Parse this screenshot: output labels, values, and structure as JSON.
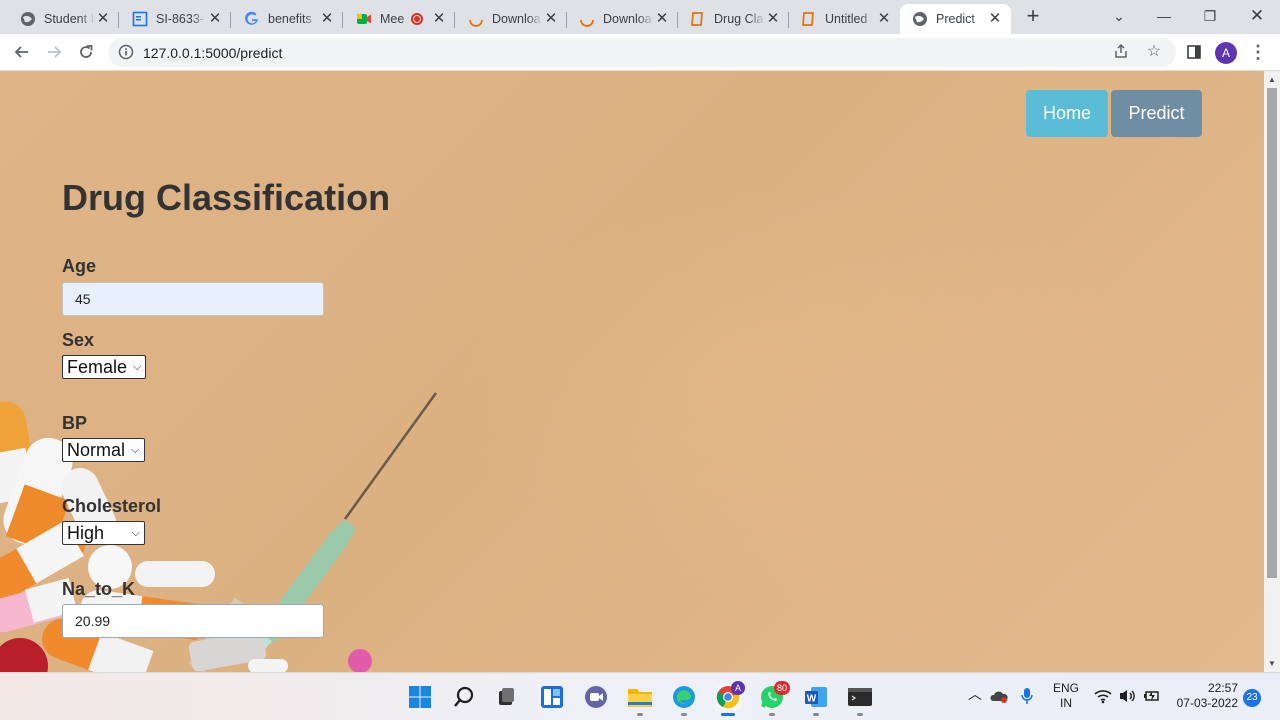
{
  "browser": {
    "tabs": [
      {
        "title": "Student I",
        "icon": "globe-icon"
      },
      {
        "title": "SI-8633-",
        "icon": "doc-icon"
      },
      {
        "title": "benefits",
        "icon": "google-icon"
      },
      {
        "title": "Mee",
        "icon": "meet-icon",
        "recording": true
      },
      {
        "title": "Downloa",
        "icon": "loading-icon"
      },
      {
        "title": "Downloa",
        "icon": "loading-icon"
      },
      {
        "title": "Drug Cla",
        "icon": "book-icon"
      },
      {
        "title": "Untitled",
        "icon": "book-icon"
      },
      {
        "title": "Predict",
        "icon": "globe-icon",
        "active": true
      }
    ],
    "url": "127.0.0.1:5000/predict",
    "profile_initial": "A"
  },
  "page": {
    "nav": {
      "home": "Home",
      "predict": "Predict"
    },
    "title": "Drug Classification",
    "form": {
      "age_label": "Age",
      "age_value": "45",
      "sex_label": "Sex",
      "sex_value": "Female",
      "bp_label": "BP",
      "bp_value": "Normal",
      "chol_label": "Cholesterol",
      "chol_value": "High",
      "na_label": "Na_to_K",
      "na_value": "20.99"
    }
  },
  "taskbar": {
    "whatsapp_badge": "80",
    "chrome_badge": "A",
    "lang_top": "ENG",
    "lang_bottom": "IN",
    "time": "22:57",
    "date": "07-03-2022",
    "notif_count": "23"
  },
  "colors": {
    "home_button": "#5bbcd8",
    "predict_button": "#6f8ea4",
    "background": "#deb488"
  }
}
